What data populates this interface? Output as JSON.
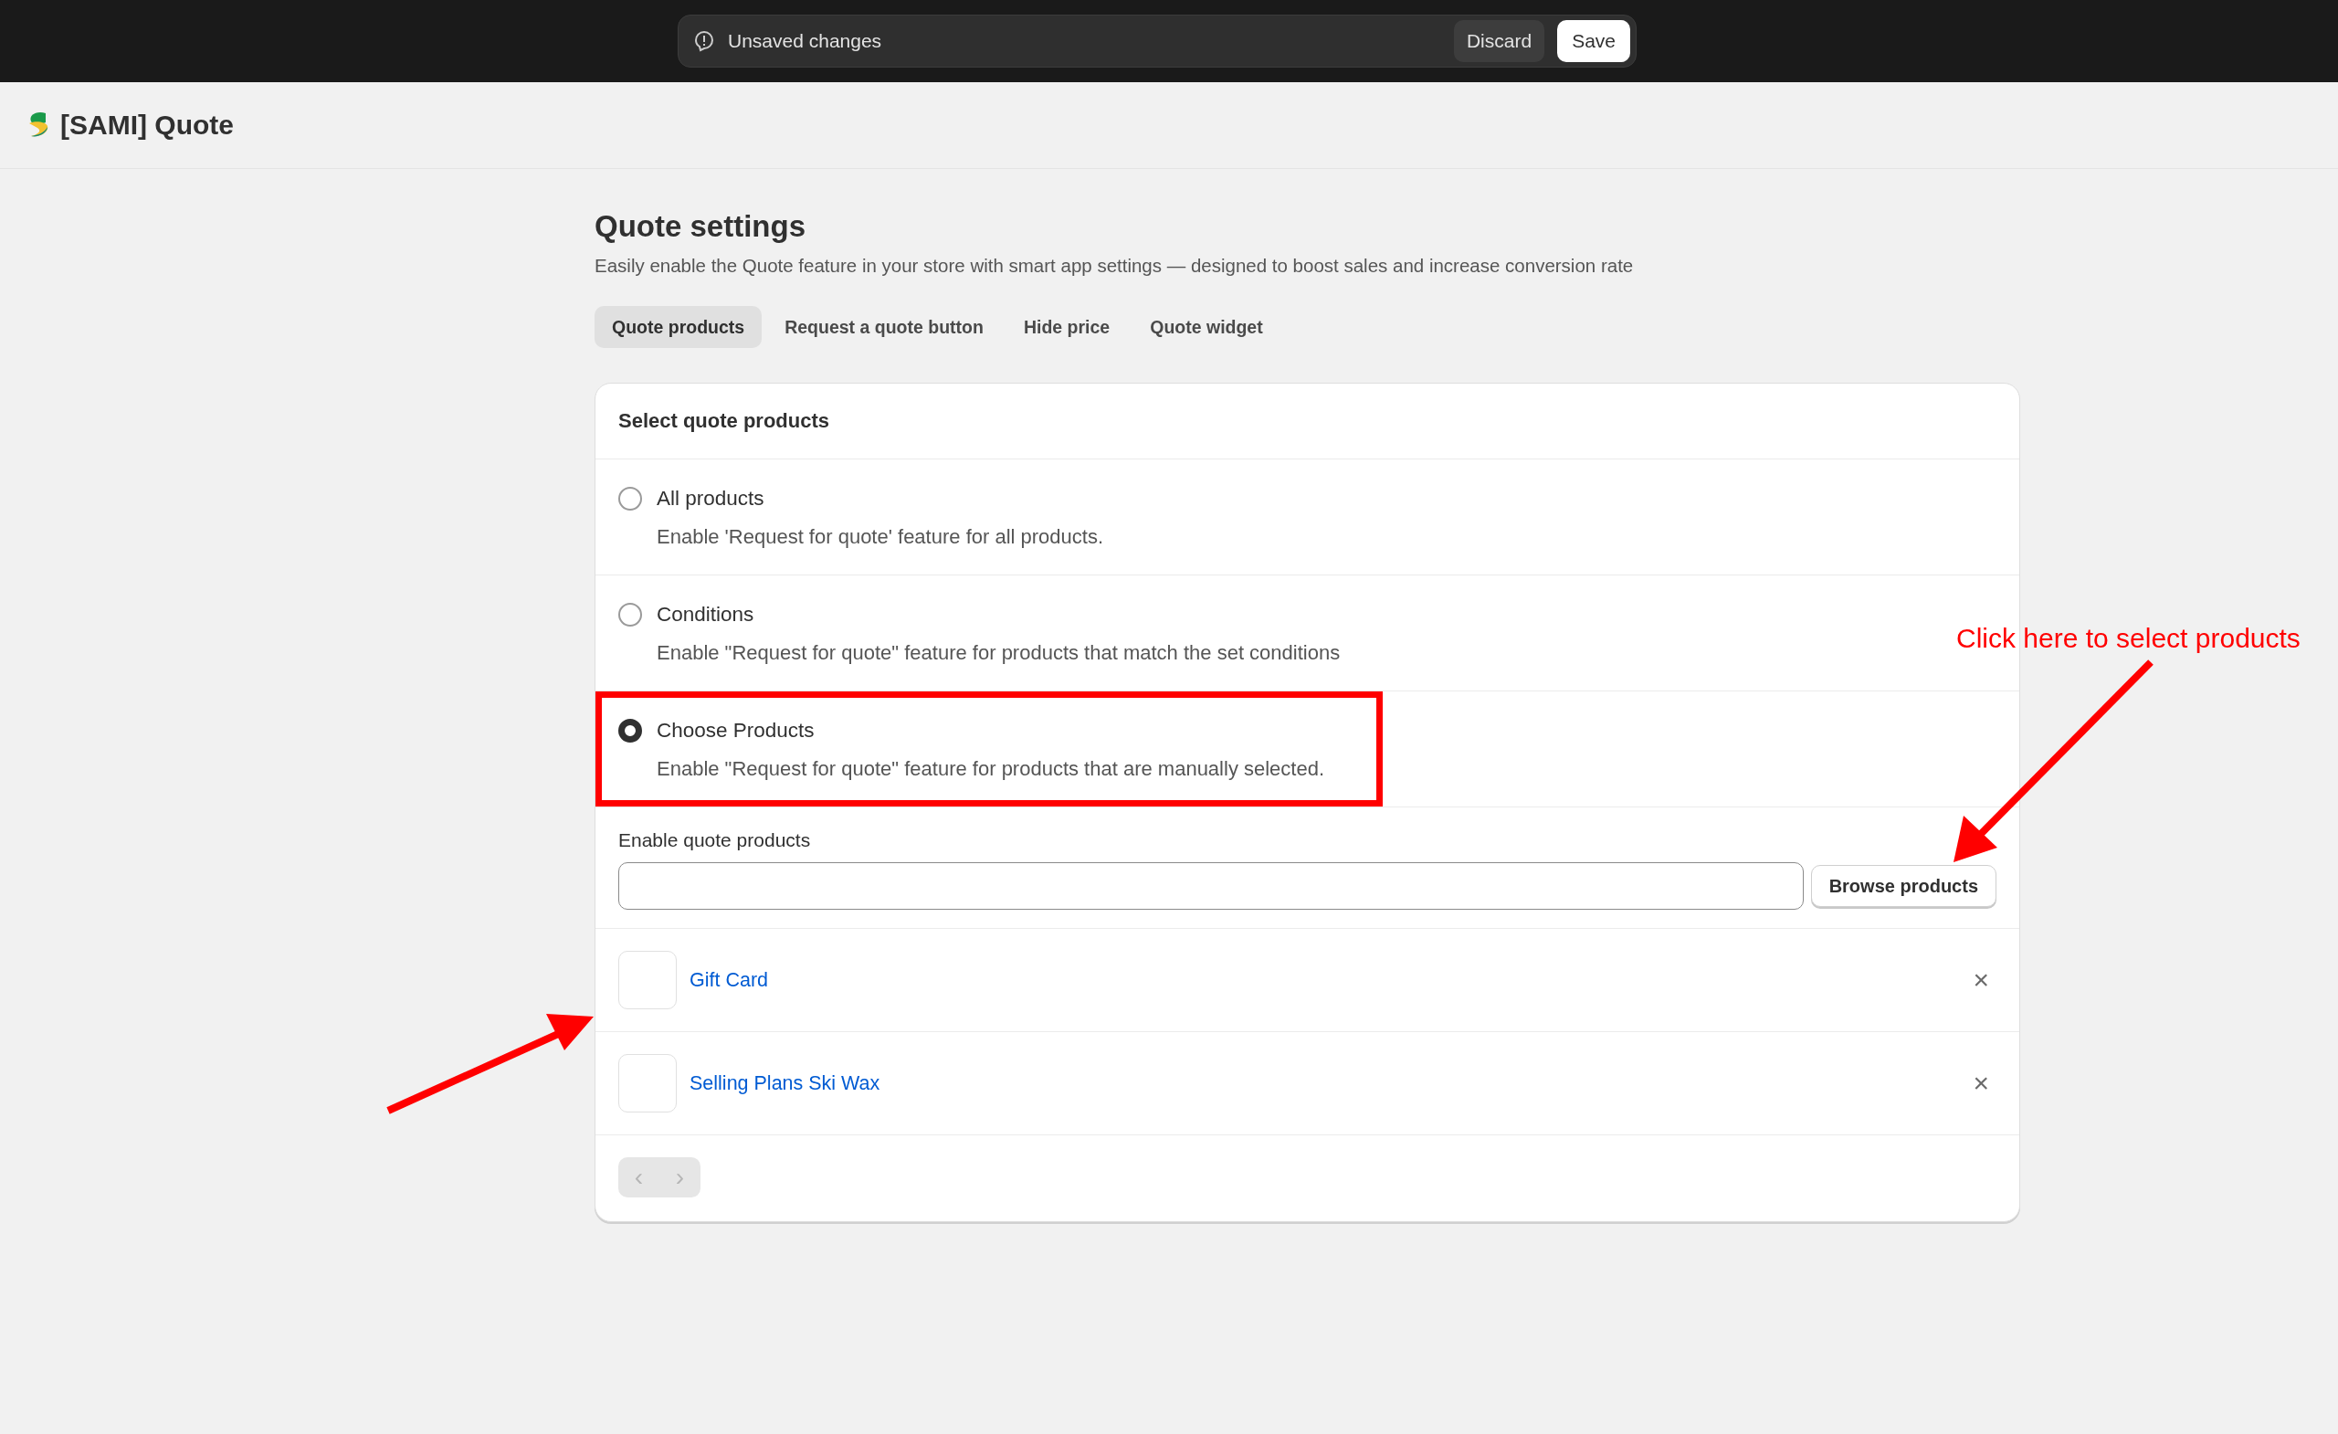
{
  "save_bar": {
    "message": "Unsaved changes",
    "buttons": [
      "Discard",
      "Save"
    ]
  },
  "app": {
    "title": "[SAMI] Quote"
  },
  "page": {
    "title": "Quote settings",
    "subtitle": "Easily enable the Quote feature in your store with smart app settings — designed to boost sales and increase conversion rate"
  },
  "tabs": [
    {
      "label": "Quote products",
      "selected": true
    },
    {
      "label": "Request a quote button",
      "selected": false
    },
    {
      "label": "Hide price",
      "selected": false
    },
    {
      "label": "Quote widget",
      "selected": false
    }
  ],
  "card": {
    "title": "Select quote products",
    "options": [
      {
        "label": "All products",
        "description": "Enable 'Request for quote' feature for all products.",
        "selected": false,
        "highlighted": false
      },
      {
        "label": "Conditions",
        "description": "Enable \"Request for quote\" feature for products that match the set conditions",
        "selected": false,
        "highlighted": false
      },
      {
        "label": "Choose Products",
        "description": "Enable \"Request for quote\" feature for products that are manually selected.",
        "selected": true,
        "highlighted": true
      }
    ],
    "picker": {
      "label": "Enable quote products",
      "button": "Browse products"
    },
    "products": [
      {
        "name": "Gift Card",
        "remove": "×"
      },
      {
        "name": "Selling Plans Ski Wax",
        "remove": "×"
      }
    ],
    "pagination": {
      "prev": "‹",
      "next": "›",
      "disabled": true
    }
  },
  "annotation": {
    "callout": "Click here to select products"
  }
}
